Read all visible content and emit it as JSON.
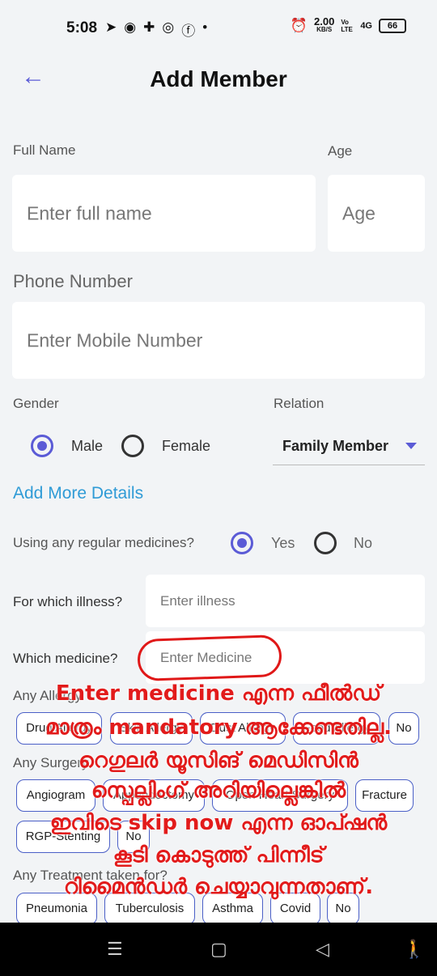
{
  "status_bar": {
    "time": "5:08",
    "left_icons": [
      "telegram-icon",
      "messenger-icon",
      "grid-app-icon",
      "instagram-icon",
      "facebook-icon",
      "dot-icon"
    ],
    "left_icon_glyphs": [
      "➤",
      "◉",
      "✚",
      "◎",
      "ⓕ",
      "•"
    ],
    "net_speed_value": "2.00",
    "net_speed_unit": "KB/S",
    "volte": "Vo LTE",
    "signal": "4G",
    "battery": "66"
  },
  "header": {
    "title": "Add Member",
    "back_glyph": "←"
  },
  "form": {
    "full_name_label": "Full Name",
    "full_name_placeholder": "Enter full name",
    "age_label": "Age",
    "age_placeholder": "Age",
    "phone_label": "Phone Number",
    "phone_placeholder": "Enter Mobile Number",
    "gender_label": "Gender",
    "gender_options": [
      "Male",
      "Female"
    ],
    "gender_selected": "Male",
    "relation_label": "Relation",
    "relation_value": "Family Member",
    "add_more": "Add More Details",
    "regular_medicines_label": "Using any regular medicines?",
    "regular_medicines_options": [
      "Yes",
      "No"
    ],
    "regular_medicines_selected": "Yes",
    "illness_label": "For which illness?",
    "illness_placeholder": "Enter illness",
    "medicine_label": "Which medicine?",
    "medicine_placeholder": "Enter Medicine",
    "allergy_label": "Any Allergy",
    "allergy_chips": [
      "Drug Allergy",
      "Skin Allergy",
      "Dust Allergy",
      "Food Allergy",
      "No"
    ],
    "surgery_label": "Any Surgery",
    "surgery_chips": [
      "Angiogram",
      "Appendectomy",
      "Open Heart Surgery",
      "Fracture",
      "RGP-Stenting",
      "No"
    ],
    "treatment_label": "Any Treatment taken for?",
    "treatment_chips": [
      "Pneumonia",
      "Tuberculosis",
      "Asthma",
      "Covid",
      "No"
    ]
  },
  "annotation": {
    "lines": [
      "Enter medicine എന്ന ഫീൽഡ്",
      "മാത്രം mandatory ആക്കേണ്ടതില്ല.",
      "റെഗുലർ യൂസിങ് മെഡിസിൻ",
      "സ്പെല്ലിംഗ് അറിയില്ലെങ്കിൽ",
      "ഇവിടെ skip now എന്ന ഓപ്ഷൻ",
      "കൂടി കൊടുത്ത് പിന്നീട്",
      "റിമൈൻഡർ ചെയ്യാവുന്നതാണ്."
    ],
    "color": "#e21b1b"
  },
  "nav_bar": {
    "menu_glyph": "☰",
    "home_glyph": "▢",
    "back_glyph": "◁",
    "accessibility_glyph": "🚶"
  },
  "colors": {
    "accent": "#5b5bd6",
    "link": "#2f9bd6",
    "chip_border": "#4a5fc7",
    "background": "#f2f4f6"
  }
}
